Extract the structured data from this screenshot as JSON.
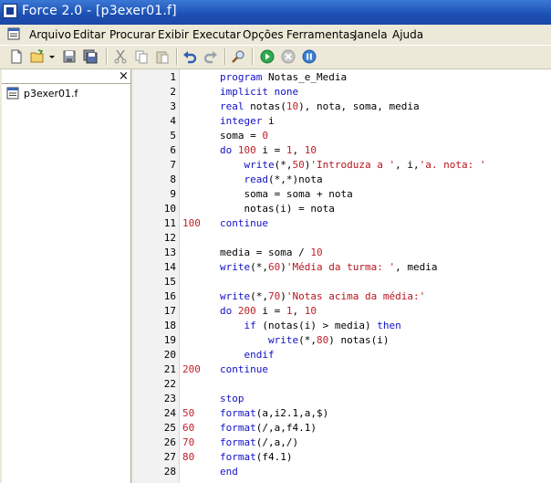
{
  "window": {
    "title": "Force 2.0 - [p3exer01.f]"
  },
  "menu": {
    "items": [
      "Arquivo",
      "Editar",
      "Procurar",
      "Exibir",
      "Executar",
      "Opções",
      "Ferramentas",
      "Janela",
      "Ajuda"
    ]
  },
  "toolbar": {
    "buttons": [
      "new-file",
      "open-file",
      "save",
      "save-all",
      "cut",
      "copy",
      "paste",
      "undo",
      "redo",
      "find",
      "run",
      "stop",
      "pause"
    ]
  },
  "panel": {
    "close_label": "×",
    "files": [
      "p3exer01.f"
    ]
  },
  "editor": {
    "lines": [
      {
        "n": "1",
        "label": "",
        "code": "program Notas_e_Media"
      },
      {
        "n": "2",
        "label": "",
        "code": "implicit none"
      },
      {
        "n": "3",
        "label": "",
        "code": "real notas(10), nota, soma, media"
      },
      {
        "n": "4",
        "label": "",
        "code": "integer i"
      },
      {
        "n": "5",
        "label": "",
        "code": "soma = 0"
      },
      {
        "n": "6",
        "label": "",
        "code": "do 100 i = 1, 10"
      },
      {
        "n": "7",
        "label": "",
        "code": "    write(*,50)'Introduza a ', i,'a. nota: '"
      },
      {
        "n": "8",
        "label": "",
        "code": "    read(*,*)nota"
      },
      {
        "n": "9",
        "label": "",
        "code": "    soma = soma + nota"
      },
      {
        "n": "10",
        "label": "",
        "code": "    notas(i) = nota"
      },
      {
        "n": "11",
        "label": "100",
        "code": "continue"
      },
      {
        "n": "12",
        "label": "",
        "code": ""
      },
      {
        "n": "13",
        "label": "",
        "code": "media = soma / 10"
      },
      {
        "n": "14",
        "label": "",
        "code": "write(*,60)'Média da turma: ', media"
      },
      {
        "n": "15",
        "label": "",
        "code": ""
      },
      {
        "n": "16",
        "label": "",
        "code": "write(*,70)'Notas acima da média:'"
      },
      {
        "n": "17",
        "label": "",
        "code": "do 200 i = 1, 10"
      },
      {
        "n": "18",
        "label": "",
        "code": "    if (notas(i) > media) then"
      },
      {
        "n": "19",
        "label": "",
        "code": "        write(*,80) notas(i)"
      },
      {
        "n": "20",
        "label": "",
        "code": "    endif"
      },
      {
        "n": "21",
        "label": "200",
        "code": "continue"
      },
      {
        "n": "22",
        "label": "",
        "code": ""
      },
      {
        "n": "23",
        "label": "",
        "code": "stop"
      },
      {
        "n": "24",
        "label": "50",
        "code": "format(a,i2.1,a,$)"
      },
      {
        "n": "25",
        "label": "60",
        "code": "format(/,a,f4.1)"
      },
      {
        "n": "26",
        "label": "70",
        "code": "format(/,a,/)"
      },
      {
        "n": "27",
        "label": "80",
        "code": "format(f4.1)"
      },
      {
        "n": "28",
        "label": "",
        "code": "end"
      }
    ]
  }
}
